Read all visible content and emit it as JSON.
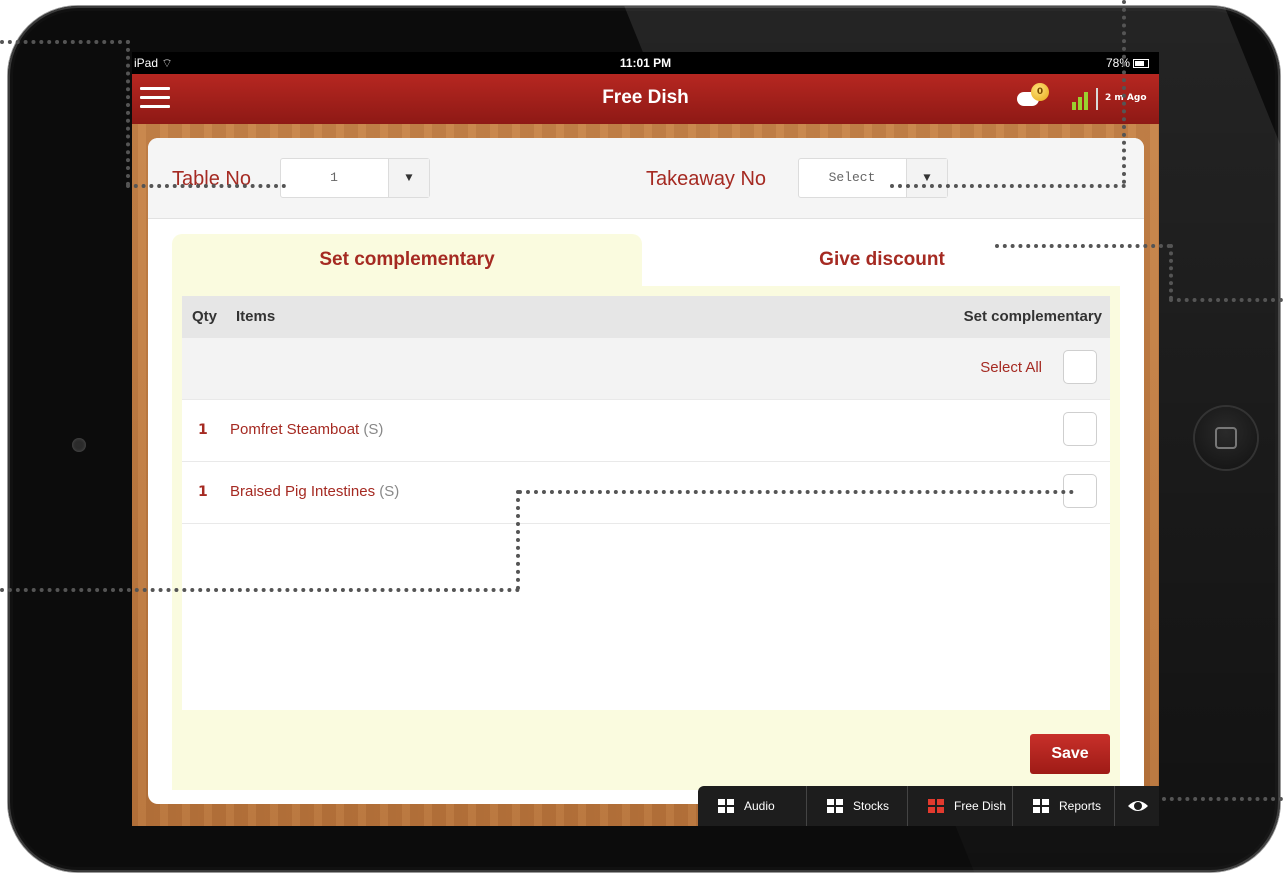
{
  "status_bar": {
    "device": "iPad",
    "time": "11:01 PM",
    "battery": "78%"
  },
  "nav": {
    "title": "Free Dish",
    "chat_badge_count": "0",
    "sync_text": "2 m Ago"
  },
  "filters": {
    "table_label": "Table No",
    "table_value": "1",
    "takeaway_label": "Takeaway No",
    "takeaway_value": "Select"
  },
  "tabs": [
    {
      "label": "Set complementary",
      "active": true
    },
    {
      "label": "Give discount",
      "active": false
    }
  ],
  "table": {
    "headers": {
      "qty": "Qty",
      "items": "Items",
      "action": "Set complementary"
    },
    "select_all": "Select All",
    "rows": [
      {
        "qty": "1",
        "name": "Pomfret Steamboat",
        "size": "(S)"
      },
      {
        "qty": "1",
        "name": "Braised Pig Intestines",
        "size": "(S)"
      }
    ]
  },
  "save_label": "Save",
  "bottom_nav": [
    {
      "label": "Audio",
      "active": false
    },
    {
      "label": "Stocks",
      "active": false
    },
    {
      "label": "Free Dish",
      "active": true
    },
    {
      "label": "Reports",
      "active": false
    }
  ],
  "colors": {
    "accent": "#a52a22",
    "navbar": "#9e1b16",
    "panel": "#fafbdf",
    "signal": "#9ad12f"
  }
}
